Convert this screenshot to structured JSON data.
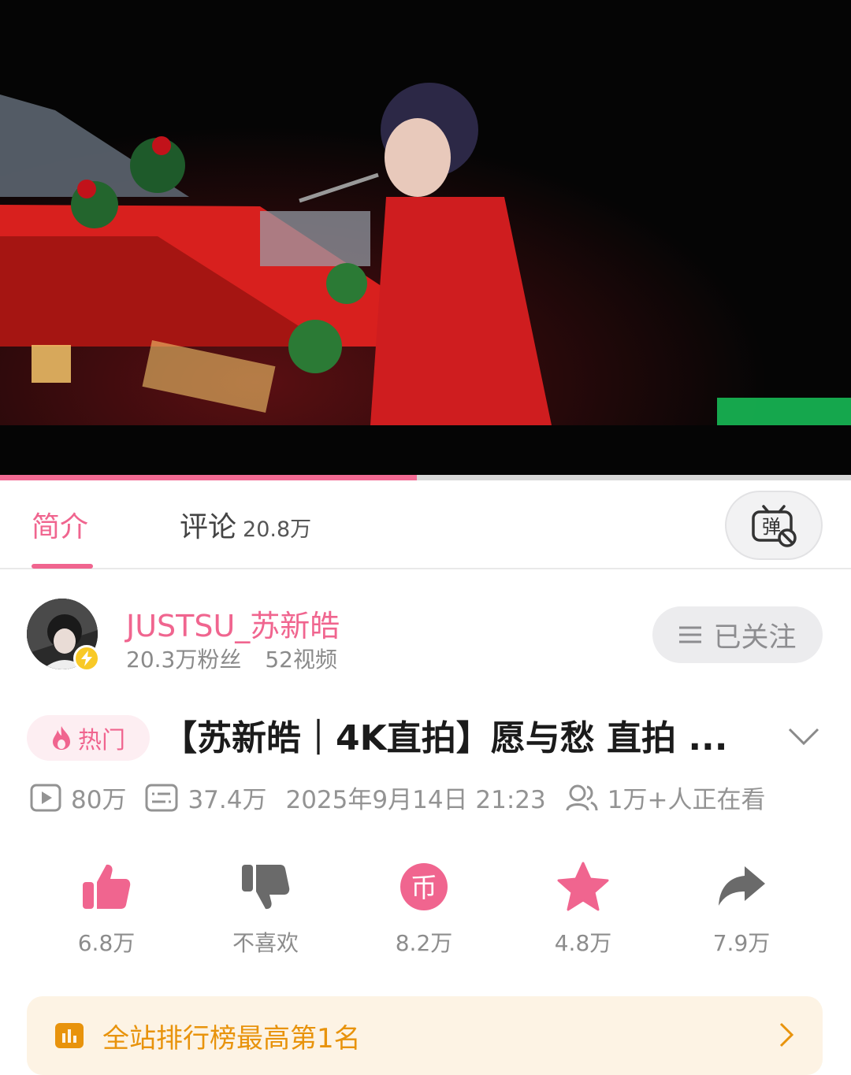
{
  "player": {
    "progress_fraction": 0.49
  },
  "tabs": {
    "intro_label": "简介",
    "comments_label": "评论",
    "comments_count": "20.8万",
    "danmaku_icon": "danmaku-off-icon"
  },
  "uploader": {
    "name": "JUSTSU_苏新皓",
    "followers": "20.3万粉丝",
    "videos": "52视频",
    "follow_label": "已关注"
  },
  "video": {
    "hot_label": "热门",
    "title": "【苏新皓｜4K直拍】愿与愁 直拍 ..."
  },
  "meta": {
    "plays": "80万",
    "danmaku": "37.4万",
    "datetime": "2025年9月14日 21:23",
    "watching": "1万+人正在看"
  },
  "actions": {
    "like": "6.8万",
    "dislike": "不喜欢",
    "coin": "8.2万",
    "favorite": "4.8万",
    "share": "7.9万"
  },
  "rank": {
    "text": "全站排行榜最高第1名"
  },
  "colors": {
    "accent": "#f0658f",
    "rank": "#e8930c"
  }
}
